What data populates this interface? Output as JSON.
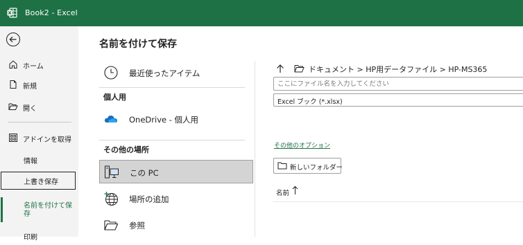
{
  "window": {
    "title": "Book2  -  Excel"
  },
  "sidebar": {
    "back": "back-arrow-icon",
    "items": [
      {
        "label": "ホーム",
        "icon": "home-icon"
      },
      {
        "label": "新規",
        "icon": "new-doc-icon"
      },
      {
        "label": "開く",
        "icon": "open-folder-icon"
      },
      {
        "label": "アドインを取得",
        "icon": "addin-grid-icon"
      },
      {
        "label": "情報"
      },
      {
        "label": "上書き保存"
      },
      {
        "label": "名前を付けて保",
        "label2": "存"
      },
      {
        "label": "印刷"
      }
    ]
  },
  "page": {
    "title": "名前を付けて保存"
  },
  "locations": {
    "recent": {
      "label": "最近使ったアイテム",
      "icon": "clock-icon"
    },
    "personal_header": "個人用",
    "onedrive": {
      "label": "OneDrive - 個人用",
      "icon": "cloud-icon"
    },
    "other_header": "その他の場所",
    "this_pc": {
      "label": "この PC",
      "icon": "computer-icon"
    },
    "add_place": {
      "label": "場所の追加",
      "icon": "globe-add-icon"
    },
    "browse": {
      "label": "参照",
      "icon": "folder-icon"
    }
  },
  "save_panel": {
    "path": "ドキュメント > HP用データファイル > HP-MS365",
    "filename_placeholder": "ここにファイル名を入力してください",
    "filetype": "Excel ブック (*.xlsx)",
    "more_options": "その他のオプション",
    "new_folder": "新しいフォルダー",
    "column_name": "名前"
  },
  "colors": {
    "accent": "#1e7145",
    "sidebar_bg": "#f3f3f3",
    "selected_bg": "#d4d4d4"
  }
}
